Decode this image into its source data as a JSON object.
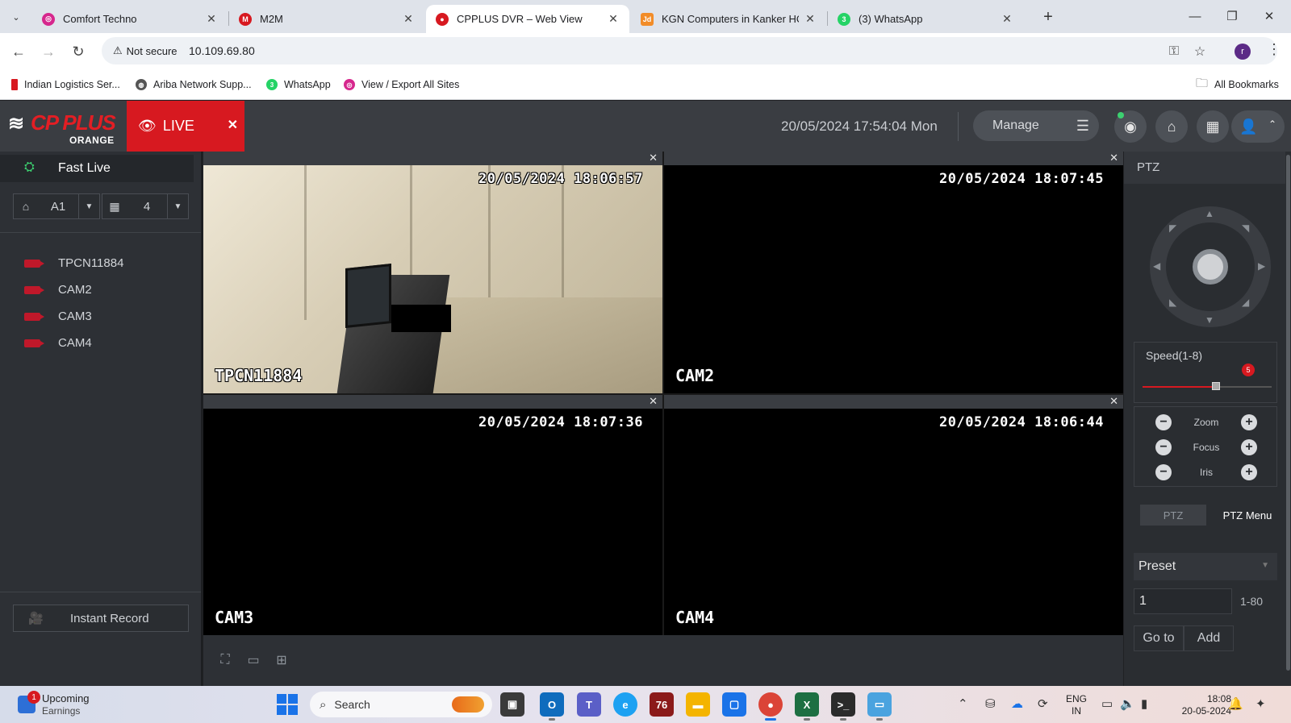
{
  "browser": {
    "tabs": [
      {
        "title": "Comfort Techno",
        "favicon_color": "#d6278d",
        "icon": "comfort-techno-favicon"
      },
      {
        "title": "M2M",
        "favicon_color": "#d71920",
        "icon": "m2m-favicon"
      },
      {
        "title": "CPPLUS DVR – Web View",
        "favicon_color": "#d71920",
        "icon": "cpplus-favicon",
        "active": true
      },
      {
        "title": "KGN Computers in Kanker HO,K",
        "favicon_color": "#f28c28",
        "icon": "justdial-favicon"
      },
      {
        "title": "(3) WhatsApp",
        "favicon_color": "#25d366",
        "icon": "whatsapp-favicon"
      }
    ],
    "address": {
      "security_label": "Not secure",
      "url": "10.109.69.80"
    },
    "profile_initial": "r",
    "bookmarks": [
      {
        "label": "Indian Logistics Ser...",
        "color": "#d71920"
      },
      {
        "label": "Ariba Network Supp...",
        "color": "#555555"
      },
      {
        "label": "WhatsApp",
        "color": "#25d366"
      },
      {
        "label": "View / Export All Sites",
        "color": "#d6278d"
      }
    ],
    "all_bookmarks_label": "All Bookmarks"
  },
  "app": {
    "logo": {
      "brand": "CP PLUS",
      "sub": "ORANGE"
    },
    "live_tab_label": "LIVE",
    "datetime": "20/05/2024 17:54:04 Mon",
    "manage_label": "Manage",
    "accent_color": "#d71920"
  },
  "left_panel": {
    "fast_live_label": "Fast Live",
    "stream_select": "A1",
    "layout_select": "4",
    "devices": [
      "TPCN11884",
      "CAM2",
      "CAM3",
      "CAM4"
    ],
    "instant_record_label": "Instant Record"
  },
  "video": {
    "cells": [
      {
        "name": "TPCN11884",
        "timestamp": "20/05/2024 18:06:57",
        "has_feed": true
      },
      {
        "name": "CAM2",
        "timestamp": "20/05/2024 18:07:45",
        "has_feed": false
      },
      {
        "name": "CAM3",
        "timestamp": "20/05/2024 18:07:36",
        "has_feed": false
      },
      {
        "name": "CAM4",
        "timestamp": "20/05/2024 18:06:44",
        "has_feed": false
      }
    ]
  },
  "ptz": {
    "title": "PTZ",
    "speed_label": "Speed(1-8)",
    "speed_value": "5",
    "speed_fraction": 0.57,
    "zoom_label": "Zoom",
    "focus_label": "Focus",
    "iris_label": "Iris",
    "tab_ptz": "PTZ",
    "tab_menu": "PTZ Menu",
    "preset_label": "Preset",
    "preset_value": "1",
    "preset_range": "1-80",
    "goto_label": "Go to",
    "add_label": "Add"
  },
  "taskbar": {
    "weather_title": "Upcoming",
    "weather_sub": "Earnings",
    "weather_badge": "1",
    "search_placeholder": "Search",
    "lang_line1": "ENG",
    "lang_line2": "IN",
    "time": "18:08",
    "date": "20-05-2024"
  }
}
